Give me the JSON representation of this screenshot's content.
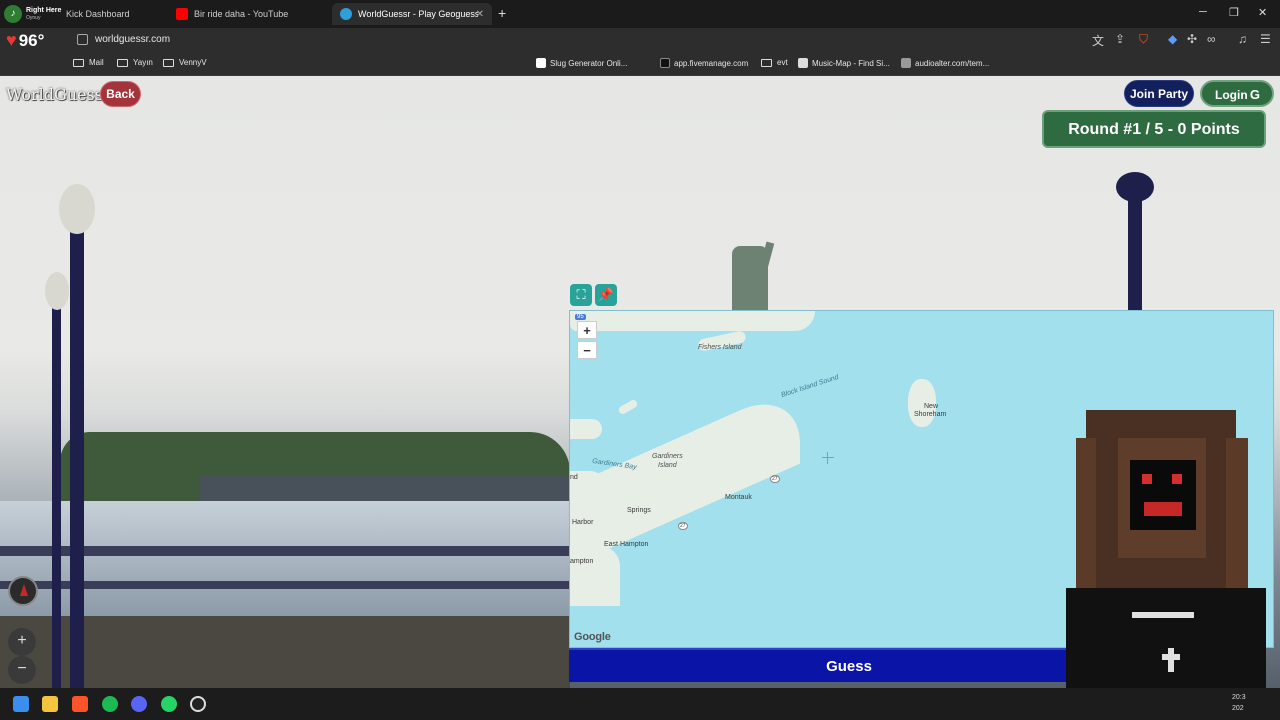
{
  "browser": {
    "media": {
      "title": "Right Here",
      "subtitle": "Oynuy"
    },
    "tabs": [
      {
        "label": "Kick Dashboard",
        "color": "#53fc18"
      },
      {
        "label": "Bir ride daha - YouTube",
        "color": "#ff0000"
      },
      {
        "label": "WorldGuessr - Play Geoguessr f...",
        "color": "#2e9fd8",
        "active": true
      }
    ],
    "temperature": "96°",
    "url": "worldguessr.com",
    "bookmarks": [
      {
        "label": "Mail",
        "type": "folder"
      },
      {
        "label": "Yayın",
        "type": "folder"
      },
      {
        "label": "VennyV",
        "type": "folder"
      },
      {
        "label": "Slug Generator Onli...",
        "type": "site"
      },
      {
        "label": "app.fivemanage.com",
        "type": "site"
      },
      {
        "label": "evt",
        "type": "folder"
      },
      {
        "label": "Music-Map - Find Si...",
        "type": "site"
      },
      {
        "label": "audioalter.com/tem...",
        "type": "site"
      }
    ]
  },
  "game": {
    "logo": "WorldGuessr",
    "back_label": "Back",
    "join_party_label": "Join Party",
    "login_label": "Login",
    "login_icon": "G",
    "round_status": "Round #1 / 5 - 0 Points",
    "guess_label": "Guess"
  },
  "map": {
    "zoom_in": "+",
    "zoom_out": "−",
    "route_shield": "95",
    "attribution": "Google",
    "labels": {
      "fishers_island": "Fishers Island",
      "block_island_sound": "Block Island Sound",
      "new_shoreham_1": "New",
      "new_shoreham_2": "Shoreham",
      "gardiners_island_1": "Gardiners",
      "gardiners_island_2": "Island",
      "gardiners_bay": "Gardiners Bay",
      "montauk": "Montauk",
      "springs": "Springs",
      "harbor": "Harbor",
      "east_hampton": "East Hampton",
      "amagansett": "ampton",
      "nd": "nd",
      "route_27": "27",
      "route_27b": "27"
    }
  },
  "taskbar": {
    "time_line1": "20:3",
    "time_line2": "202"
  }
}
